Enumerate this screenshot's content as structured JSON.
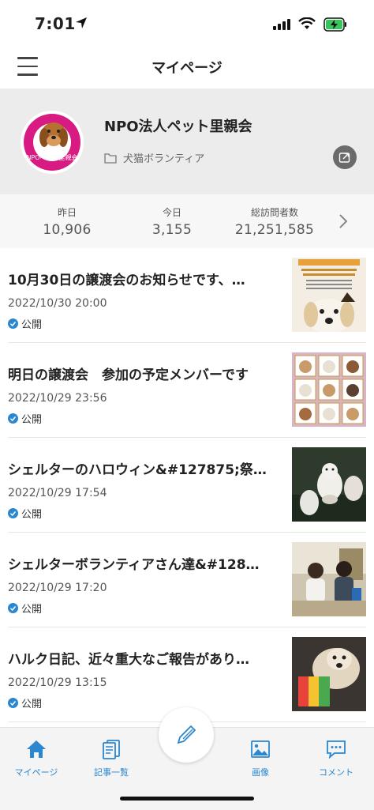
{
  "status_bar": {
    "time": "7:01"
  },
  "nav": {
    "title": "マイページ"
  },
  "profile": {
    "name": "NPO法人ペット里親会",
    "category": "犬猫ボランティア",
    "logo_text": "NPOペット里親会"
  },
  "stats": [
    {
      "label": "昨日",
      "value": "10,906"
    },
    {
      "label": "今日",
      "value": "3,155"
    },
    {
      "label": "総訪問者数",
      "value": "21,251,585"
    }
  ],
  "articles": [
    {
      "title": "10月30日の譲渡会のお知らせです、…",
      "date": "2022/10/30 20:00",
      "status": "公開"
    },
    {
      "title": "明日の譲渡会　参加の予定メンバーです",
      "date": "2022/10/29 23:56",
      "status": "公開"
    },
    {
      "title": "シェルターのハロウィン&#127875;祭…",
      "date": "2022/10/29 17:54",
      "status": "公開"
    },
    {
      "title": "シェルターボランティアさん達&#128…",
      "date": "2022/10/29 17:20",
      "status": "公開"
    },
    {
      "title": "ハルク日記、近々重大なご報告があり…",
      "date": "2022/10/29 13:15",
      "status": "公開"
    }
  ],
  "tabs": [
    {
      "label": "マイページ",
      "icon": "home-icon"
    },
    {
      "label": "記事一覧",
      "icon": "articles-icon"
    },
    {
      "label": "画像",
      "icon": "image-icon"
    },
    {
      "label": "コメント",
      "icon": "comment-icon"
    }
  ],
  "colors": {
    "accent": "#2a87d0",
    "profile_bg": "#ececec",
    "badge": "#2a87d0"
  }
}
